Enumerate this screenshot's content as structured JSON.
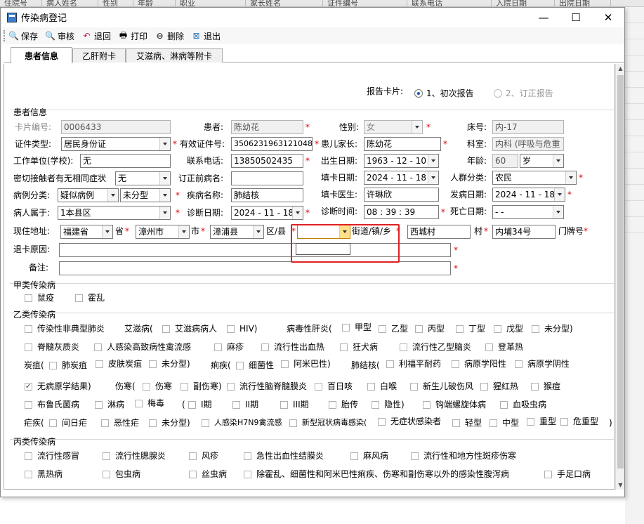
{
  "background": {
    "columns": [
      "住院号",
      "病人姓名",
      "性别",
      "年龄",
      "职业",
      "家长姓名",
      "证件编号",
      "联系电话",
      "入院日期",
      "出院日期"
    ]
  },
  "window": {
    "title": "传染病登记",
    "minimize": "—",
    "maximize": "☐",
    "close": "✕"
  },
  "toolbar": {
    "save": "保存",
    "audit": "审核",
    "back": "退回",
    "print": "打印",
    "delete": "删除",
    "exit": "退出"
  },
  "tabs": [
    "患者信息",
    "乙肝附卡",
    "艾滋病、淋病等附卡"
  ],
  "report": {
    "label": "报告卡片:",
    "opt1": "1、初次报告",
    "opt2": "2、订正报告"
  },
  "patient": {
    "section": "患者信息",
    "card_no_label": "卡片编号:",
    "card_no": "0006433",
    "name_label": "患者:",
    "name": "陈幼花",
    "sex_label": "性别:",
    "sex": "女",
    "bed_label": "床号:",
    "bed": "内-17",
    "id_type_label": "证件类型:",
    "id_type": "居民身份证",
    "id_no_label": "有效证件号:",
    "id_no": "350623196312104840",
    "guardian_label": "患儿家长:",
    "guardian": "陈幼花",
    "dept_label": "科室:",
    "dept": "内科 (呼吸与危重",
    "work_label": "工作单位(学校):",
    "work": "无",
    "phone_label": "联系电话:",
    "phone": "13850502435",
    "birth_label": "出生日期:",
    "birth": "1963 - 12 - 10",
    "age_label": "年龄:",
    "age": "60",
    "age_unit": "岁",
    "contact_label": "密切接触者有无相同症状",
    "contact": "无",
    "prev_disease_label": "订正前病名:",
    "prev_disease": "",
    "fill_date_label": "填卡日期:",
    "fill_date": "2024 - 11 - 18",
    "group_label": "人群分类:",
    "group": "农民",
    "case_type_label": "病例分类:",
    "case_type": "疑似病例",
    "case_sub": "未分型",
    "disease_label": "疾病名称:",
    "disease": "肺结核",
    "doctor_label": "填卡医生:",
    "doctor": "许琳欣",
    "onset_label": "发病日期:",
    "onset": "2024 - 11 - 18",
    "belong_label": "病人属于:",
    "belong": "1本县区",
    "diag_date_label": "诊断日期:",
    "diag_date": "2024 - 11 - 18",
    "diag_time_label": "诊断时间:",
    "diag_time": "08 : 39 : 39",
    "death_label": "死亡日期:",
    "death": "  -    -  ",
    "addr_label": "现住地址:",
    "province": "福建省",
    "province_u": "省",
    "city": "漳州市",
    "city_u": "市",
    "county": "漳浦县",
    "county_u": "区/县",
    "street": "",
    "street_u": "街道/镇/乡",
    "village": "西城村",
    "village_u": "村",
    "house": "内埔34号",
    "house_u": "门牌号",
    "return_label": "退卡原因:",
    "return_reason": "",
    "remark_label": "备注:",
    "remark": ""
  },
  "class_a": {
    "title": "甲类传染病",
    "items": [
      "鼠疫",
      "霍乱"
    ]
  },
  "class_b": {
    "title": "乙类传染病",
    "r1": {
      "a": "传染性非典型肺炎",
      "aids": "艾滋病(",
      "aids1": "艾滋病病人",
      "aids2": "HIV)",
      "hep": "病毒性肝炎(",
      "h1": "甲型",
      "h2": "乙型",
      "h3": "丙型",
      "h4": "丁型",
      "h5": "戊型",
      "h6": "未分型)"
    },
    "r2": [
      "脊髓灰质炎",
      "人感染高致病性禽流感",
      "麻疹",
      "流行性出血热",
      "狂犬病",
      "流行性乙型脑炎",
      "登革热"
    ],
    "r3": {
      "anthrax": "炭疽(",
      "a1": "肺炭疽",
      "a2": "皮肤炭疽",
      "a3": "未分型)",
      "dys": "痢疾(",
      "d1": "细菌性",
      "d2": "阿米巴性)",
      "tb": "肺结核(",
      "t1": "利福平耐药",
      "t2": "病原学阳性",
      "t3": "病原学阴性"
    },
    "r4": {
      "t4": "无病原学结果)",
      "typh": "伤寒(",
      "y1": "伤寒",
      "y2": "副伤寒)",
      "c1": "流行性脑脊髓膜炎",
      "c2": "百日咳",
      "c3": "白喉",
      "c4": "新生儿破伤风",
      "c5": "猩红热",
      "c6": "猴痘"
    },
    "r5": {
      "b1": "布鲁氏菌病",
      "b2": "淋病",
      "syph": "梅毒",
      "paren": "(",
      "s1": "I期",
      "s2": "II期",
      "s3": "III期",
      "s4": "胎传",
      "s5": "隐性)",
      "lep": "钩端螺旋体病",
      "schis": "血吸虫病"
    },
    "r6": {
      "mal": "疟疾(",
      "m1": "间日疟",
      "m2": "恶性疟",
      "m3": "未分型)",
      "h7n9": "人感染H7N9禽流感",
      "covid": "新型冠状病毒感染(",
      "v1": "无症状感染者",
      "v2": "轻型",
      "v3": "中型",
      "v4": "重型",
      "v5": "危重型",
      "close": ")"
    }
  },
  "class_c": {
    "title": "丙类传染病",
    "r1": [
      "流行性感冒",
      "流行性腮腺炎",
      "风疹",
      "急性出血性结膜炎",
      "麻风病",
      "流行性和地方性斑疹伤寒"
    ],
    "r2": [
      "黑热病",
      "包虫病",
      "丝虫病",
      "除霍乱、细菌性和阿米巴性痢疾、伤寒和副伤寒以外的感染性腹泻病",
      "手足口病"
    ]
  }
}
